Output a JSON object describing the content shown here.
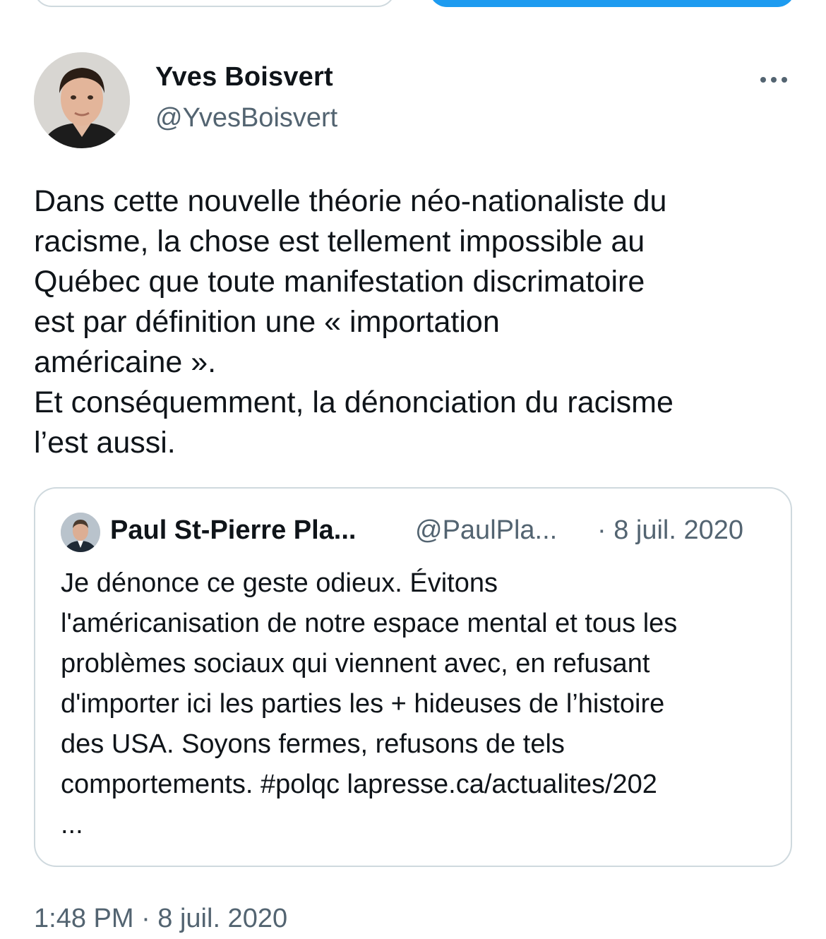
{
  "tweet": {
    "author_name": "Yves Boisvert",
    "author_handle": "@YvesBoisvert",
    "text": "Dans cette nouvelle théorie néo-nationaliste du\nracisme, la chose est tellement impossible au\nQuébec que toute manifestation discrimatoire\nest par définition une « importation\naméricaine ».\nEt conséquemment, la dénonciation du racisme\nl’est aussi.",
    "timestamp": "1:48 PM · 8 juil. 2020"
  },
  "quote": {
    "author_name": "Paul St-Pierre Pla...",
    "author_handle": "@PaulPla...",
    "date": "· 8 juil. 2020",
    "text": "Je dénonce ce geste odieux. Évitons\nl'américanisation de notre espace mental et tous les\nproblèmes sociaux qui viennent avec, en refusant\nd'importer ici les parties les + hideuses de l’histoire\ndes USA. Soyons fermes, refusons de tels\ncomportements. #polqc lapresse.ca/actualites/202\n..."
  },
  "icons": {
    "more": "more-horizontal-icon"
  },
  "colors": {
    "accent": "#1d9bf0",
    "secondary_text": "#536471",
    "border": "#cfd9de"
  }
}
